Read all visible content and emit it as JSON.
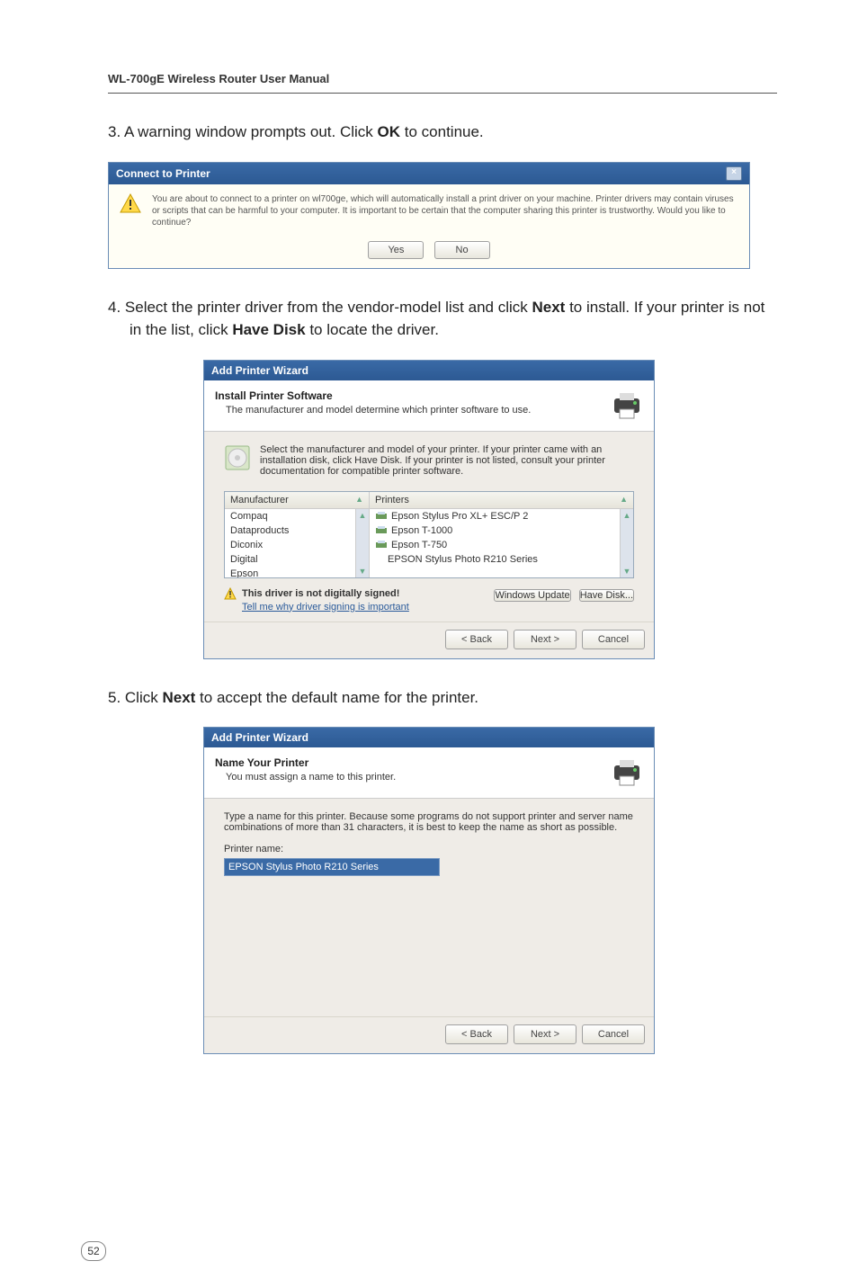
{
  "header": "WL-700gE Wireless Router User Manual",
  "step3_prefix": "3.   A warning window prompts out. Click ",
  "step3_bold": "OK",
  "step3_suffix": " to continue.",
  "dialog1": {
    "title": "Connect to Printer",
    "warning_text": "You are about to connect to a printer on wl700ge, which will automatically install a print driver on your machine. Printer drivers may contain viruses or scripts that can be harmful to your computer. It is important to be certain that the computer sharing this printer is trustworthy. Would you like to continue?",
    "btn_yes": "Yes",
    "btn_no": "No"
  },
  "step4_prefix": "4.   Select the printer driver from the vendor-model list and click ",
  "step4_bold1": "Next",
  "step4_mid": " to install. If your printer is not in the list, click ",
  "step4_bold2": "Have Disk",
  "step4_suffix": " to locate the driver.",
  "wizard1": {
    "titlebar": "Add Printer Wizard",
    "heading": "Install Printer Software",
    "subheading": "The manufacturer and model determine which printer software to use.",
    "info": "Select the manufacturer and model of your printer. If your printer came with an installation disk, click Have Disk. If your printer is not listed, consult your printer documentation for compatible printer software.",
    "col1_head": "Manufacturer",
    "col2_head": "Printers",
    "manufacturers": [
      "Compaq",
      "Dataproducts",
      "Diconix",
      "Digital",
      "Epson"
    ],
    "printers": [
      "Epson Stylus Pro XL+ ESC/P 2",
      "Epson T-1000",
      "Epson T-750",
      "EPSON Stylus Photo R210 Series"
    ],
    "not_signed": "This driver is not digitally signed!",
    "link": "Tell me why driver signing is important",
    "btn_winupdate": "Windows Update",
    "btn_havedisk": "Have Disk...",
    "btn_back": "< Back",
    "btn_next": "Next >",
    "btn_cancel": "Cancel"
  },
  "step5_prefix": "5. Click ",
  "step5_bold": "Next",
  "step5_suffix": " to accept the default name for the printer.",
  "wizard2": {
    "titlebar": "Add Printer Wizard",
    "heading": "Name Your Printer",
    "subheading": "You must assign a name to this printer.",
    "body": "Type a name for this printer. Because some programs do not support printer and server name combinations of more than 31 characters, it is best to keep the name as short as possible.",
    "label": "Printer name:",
    "value": "EPSON Stylus Photo R210 Series",
    "btn_back": "< Back",
    "btn_next": "Next >",
    "btn_cancel": "Cancel"
  },
  "page_number": "52"
}
